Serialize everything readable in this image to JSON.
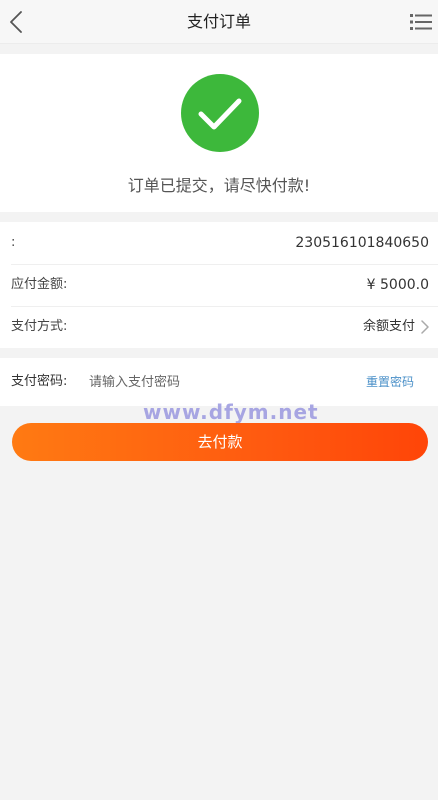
{
  "header": {
    "title": "支付订单",
    "back_icon": "chevron-left-icon",
    "menu_icon": "list-menu-icon"
  },
  "success": {
    "icon": "check-circle-icon",
    "icon_color": "#3db83b",
    "message": "订单已提交，请尽快付款!"
  },
  "order": {
    "number_label": ":",
    "number_value": "230516101840650",
    "amount_label": "应付金额:",
    "amount_value": "¥ 5000.0",
    "method_label": "支付方式:",
    "method_value": "余额支付"
  },
  "password": {
    "label": "支付密码:",
    "placeholder": "请输入支付密码",
    "reset_label": "重置密码"
  },
  "watermark": "www.dfym.net",
  "pay_button": {
    "label": "去付款",
    "color_start": "#ff7a12",
    "color_end": "#ff4508"
  }
}
